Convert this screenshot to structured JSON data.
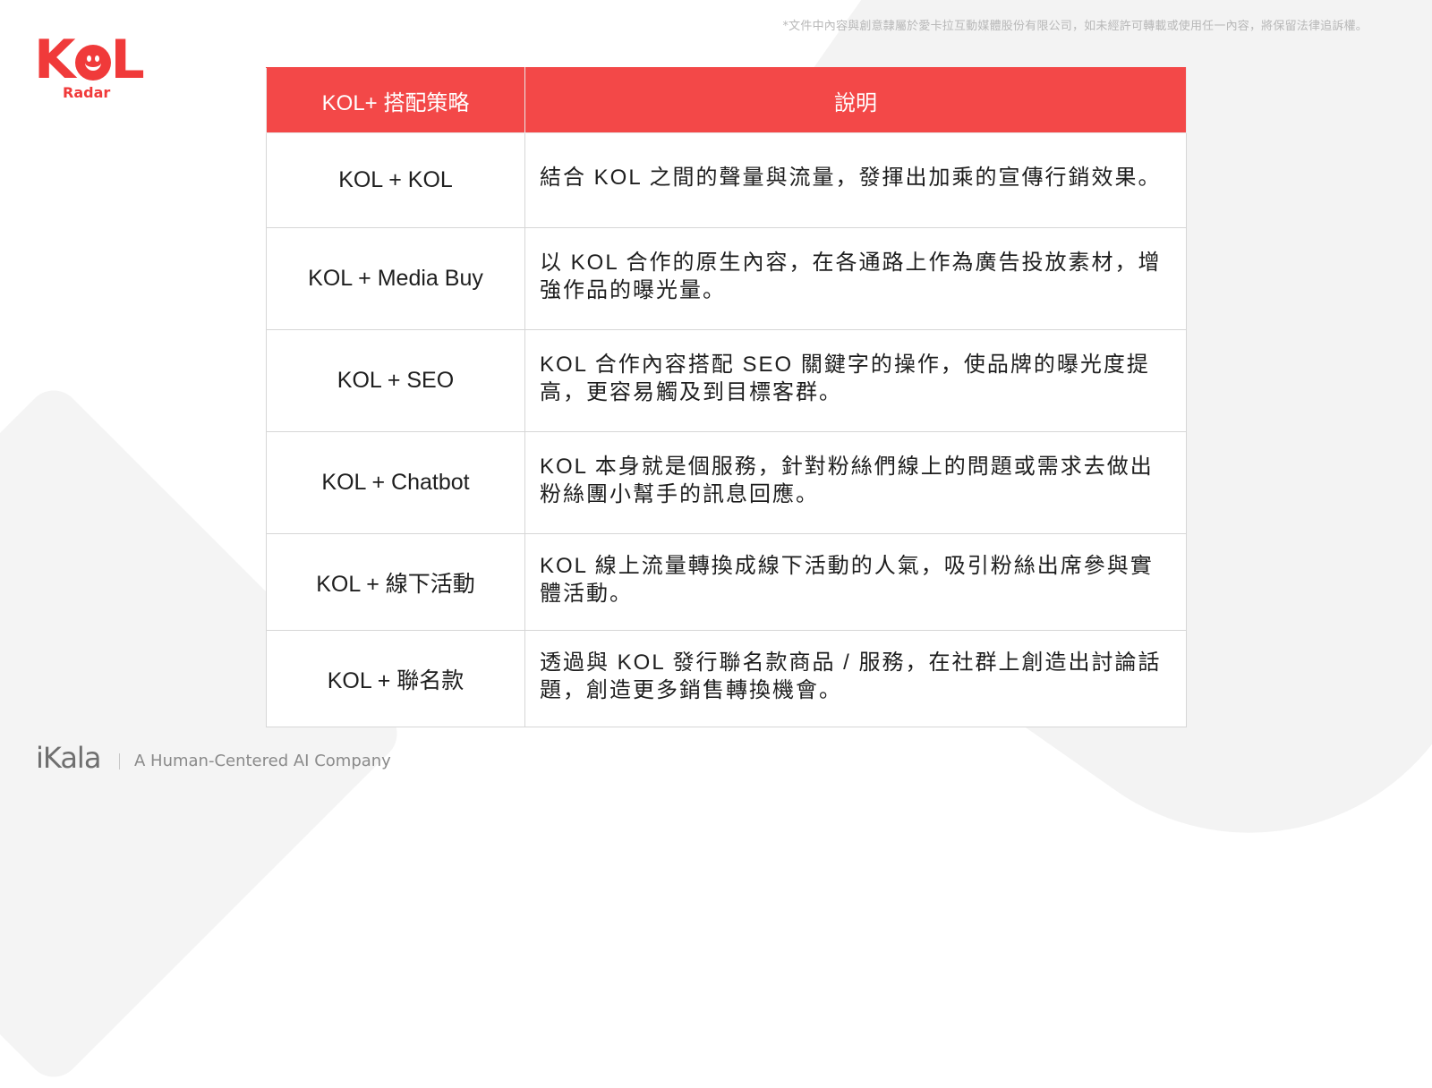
{
  "copyright": "*文件中內容與創意隸屬於愛卡拉互動媒體股份有限公司，如未經許可轉載或使用任一內容，將保留法律追訴權。",
  "logo": {
    "main_left": "K",
    "main_right": "L",
    "sub": "Radar",
    "brand_color": "#f03a3a"
  },
  "table": {
    "headers": {
      "strategy": "KOL+ 搭配策略",
      "description": "說明"
    },
    "header_color": "#f34848",
    "rows": [
      {
        "strategy": "KOL + KOL",
        "description": "結合 KOL 之間的聲量與流量，發揮出加乘的宣傳行銷效果。"
      },
      {
        "strategy": "KOL + Media Buy",
        "description": "以 KOL 合作的原生內容，在各通路上作為廣告投放素材，增強作品的曝光量。"
      },
      {
        "strategy": "KOL + SEO",
        "description": "KOL 合作內容搭配 SEO 關鍵字的操作，使品牌的曝光度提高，更容易觸及到目標客群。"
      },
      {
        "strategy": "KOL + Chatbot",
        "description": "KOL 本身就是個服務，針對粉絲們線上的問題或需求去做出粉絲團小幫手的訊息回應。"
      },
      {
        "strategy": "KOL + 線下活動",
        "description": "KOL 線上流量轉換成線下活動的人氣，吸引粉絲出席參與實體活動。"
      },
      {
        "strategy": "KOL + 聯名款",
        "description": "透過與 KOL 發行聯名款商品 / 服務，在社群上創造出討論話題，創造更多銷售轉換機會。"
      }
    ]
  },
  "footer": {
    "brand": "iKala",
    "tagline": "A Human-Centered AI Company"
  }
}
